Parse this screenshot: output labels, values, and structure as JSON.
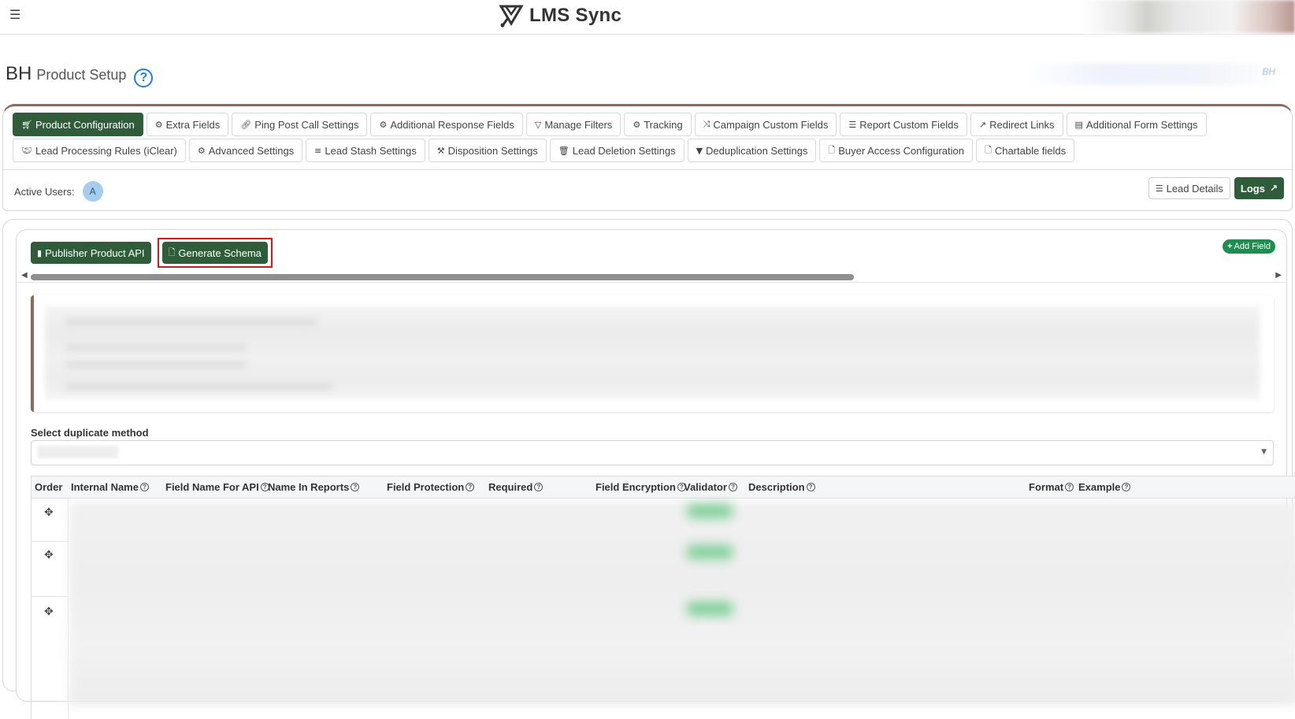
{
  "topbar": {
    "menu_icon": "hamburger-icon",
    "logo_icon": "lms-sync-logo-icon",
    "app_name": "LMS Sync"
  },
  "page": {
    "code": "BH",
    "title": "Product Setup",
    "help_icon": "question-circle-icon",
    "header_right_text": "BH"
  },
  "tabs_row1": [
    {
      "label": "Product Configuration",
      "icon": "cart-icon",
      "active": true
    },
    {
      "label": "Extra Fields",
      "icon": "gears-icon"
    },
    {
      "label": "Ping Post Call Settings",
      "icon": "link-icon"
    },
    {
      "label": "Additional Response Fields",
      "icon": "gears-icon"
    },
    {
      "label": "Manage Filters",
      "icon": "filter-icon"
    },
    {
      "label": "Tracking",
      "icon": "gears-icon"
    },
    {
      "label": "Campaign Custom Fields",
      "icon": "shuffle-icon"
    },
    {
      "label": "Report Custom Fields",
      "icon": "list-ol-icon"
    },
    {
      "label": "Redirect Links",
      "icon": "external-link-icon"
    },
    {
      "label": "Additional Form Settings",
      "icon": "form-icon"
    }
  ],
  "tabs_row2": [
    {
      "label": "Lead Processing Rules (iClear)",
      "icon": "handshake-icon"
    },
    {
      "label": "Advanced Settings",
      "icon": "gear-icon"
    },
    {
      "label": "Lead Stash Settings",
      "icon": "database-icon"
    },
    {
      "label": "Disposition Settings",
      "icon": "gavel-icon"
    },
    {
      "label": "Lead Deletion Settings",
      "icon": "trash-icon"
    },
    {
      "label": "Deduplication Settings",
      "icon": "filter-icon"
    },
    {
      "label": "Buyer Access Configuration",
      "icon": "file-icon"
    },
    {
      "label": "Chartable fields",
      "icon": "file-icon"
    }
  ],
  "active_users": {
    "label": "Active Users:",
    "avatar_letter": "A"
  },
  "right_actions": {
    "lead_details": "Lead Details",
    "logs": "Logs"
  },
  "actions": {
    "publisher_api": "Publisher Product API",
    "generate_schema": "Generate Schema",
    "add_field": "Add Field"
  },
  "dedupe": {
    "label": "Select duplicate method"
  },
  "table": {
    "columns": [
      {
        "label": "Order",
        "help": false
      },
      {
        "label": "Internal Name",
        "help": true
      },
      {
        "label": "Field Name For API",
        "help": true
      },
      {
        "label": "Name In Reports",
        "help": true
      },
      {
        "label": "Field Protection",
        "help": true
      },
      {
        "label": "Required",
        "help": true
      },
      {
        "label": "Field Encryption",
        "help": true
      },
      {
        "label": "Validator",
        "help": true
      },
      {
        "label": "Description",
        "help": true
      },
      {
        "label": "Format",
        "help": true
      },
      {
        "label": "Example",
        "help": true
      }
    ],
    "rows": 3
  },
  "colors": {
    "primary_dark_green": "#2f5d3a",
    "accent_green": "#1e8e4f",
    "highlight_red": "#d9171b",
    "card_accent": "#8a6b63",
    "help_blue": "#1e7fe6"
  }
}
